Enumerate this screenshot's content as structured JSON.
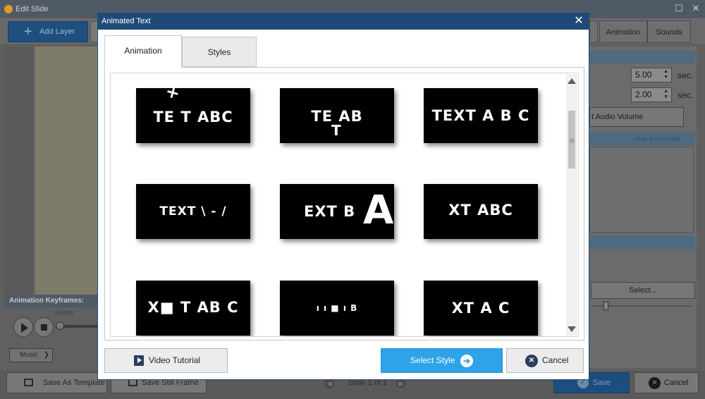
{
  "background_window": {
    "title": "Edit Slide",
    "toolbar": {
      "add_layer_label": "Add Layer"
    },
    "tabs": [
      {
        "label": "Animation"
      },
      {
        "label": "Sounds"
      }
    ],
    "keyframes": {
      "title": "Animation Keyframes:",
      "time": "0:00.000",
      "music_label": "Music"
    },
    "right_panel": {
      "duration_value": "5.00",
      "transition_value": "2.00",
      "unit": "sec.",
      "audio_button": "t Audio Volume",
      "hide_thumbnails": "Hide thumbnails",
      "select_button": "Select..."
    },
    "bottom_bar": {
      "save_template": "Save As Template",
      "save_still": "Save Still Frame",
      "slide_indicator": "Slide 1 of 1",
      "save": "Save",
      "cancel": "Cancel"
    }
  },
  "dialog": {
    "title": "Animated Text",
    "tabs": [
      {
        "label": "Animation",
        "active": true
      },
      {
        "label": "Styles",
        "active": false
      }
    ],
    "thumbnails": [
      {
        "text": "TE   T ABC",
        "variant": "plus-top"
      },
      {
        "text": "TE     AB",
        "variant": "t-drop"
      },
      {
        "text": "TEXT A B C",
        "variant": "spaced"
      },
      {
        "text": "TEXT  \\ - /",
        "variant": "scatter"
      },
      {
        "text": "EXT  B",
        "variant": "big-a"
      },
      {
        "text": "XT ABC",
        "variant": "raised-x"
      },
      {
        "text": "X■ T AB C",
        "variant": "blur"
      },
      {
        "text": "ı  ı  ■  ı  B",
        "variant": "fragments"
      },
      {
        "text": "XT  A C",
        "variant": "gap"
      }
    ],
    "buttons": {
      "video_tutorial": "Video Tutorial",
      "select_style": "Select Style",
      "cancel": "Cancel"
    }
  }
}
